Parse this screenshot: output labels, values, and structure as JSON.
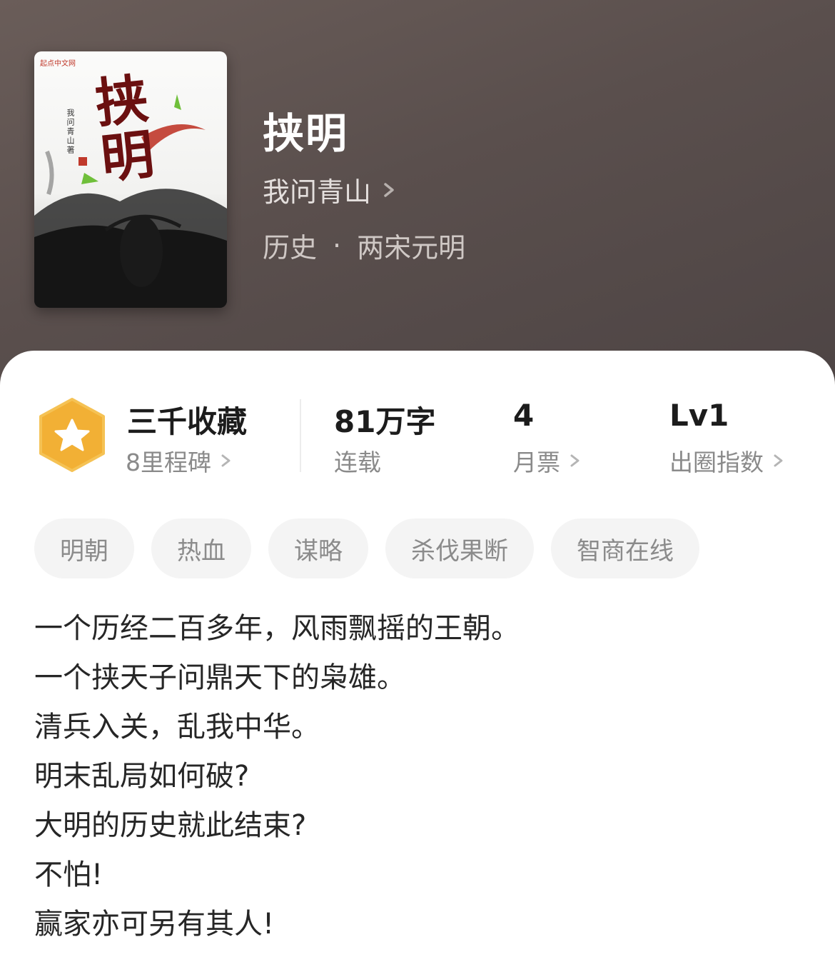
{
  "colors": {
    "header_bg": "#5d5351",
    "card_bg": "#ffffff",
    "badge_orange": "#f2b035",
    "tag_bg": "#f4f4f4",
    "muted_text": "#8a8a8a"
  },
  "book": {
    "cover": {
      "publisher_mark": "起点中文网",
      "title_art": "挟明",
      "author_vertical": "我问青山著"
    },
    "title": "挟明",
    "author": "我问青山",
    "category": "历史",
    "subcategory": "两宋元明",
    "separator": "·"
  },
  "stats": {
    "collection": {
      "title": "三千收藏",
      "subtitle": "8里程碑",
      "icon": "star-hexagon-badge-icon"
    },
    "words": {
      "value": "81万字",
      "label": "连载"
    },
    "monthly_tickets": {
      "value": "4",
      "label": "月票"
    },
    "popularity": {
      "value": "Lv1",
      "label": "出圈指数"
    }
  },
  "tags": [
    "明朝",
    "热血",
    "谋略",
    "杀伐果断",
    "智商在线"
  ],
  "synopsis": [
    "一个历经二百多年，风雨飘摇的王朝。",
    "一个挟天子问鼎天下的枭雄。",
    "清兵入关，乱我中华。",
    "明末乱局如何破?",
    "大明的历史就此结束?",
    "不怕!",
    "赢家亦可另有其人!"
  ]
}
